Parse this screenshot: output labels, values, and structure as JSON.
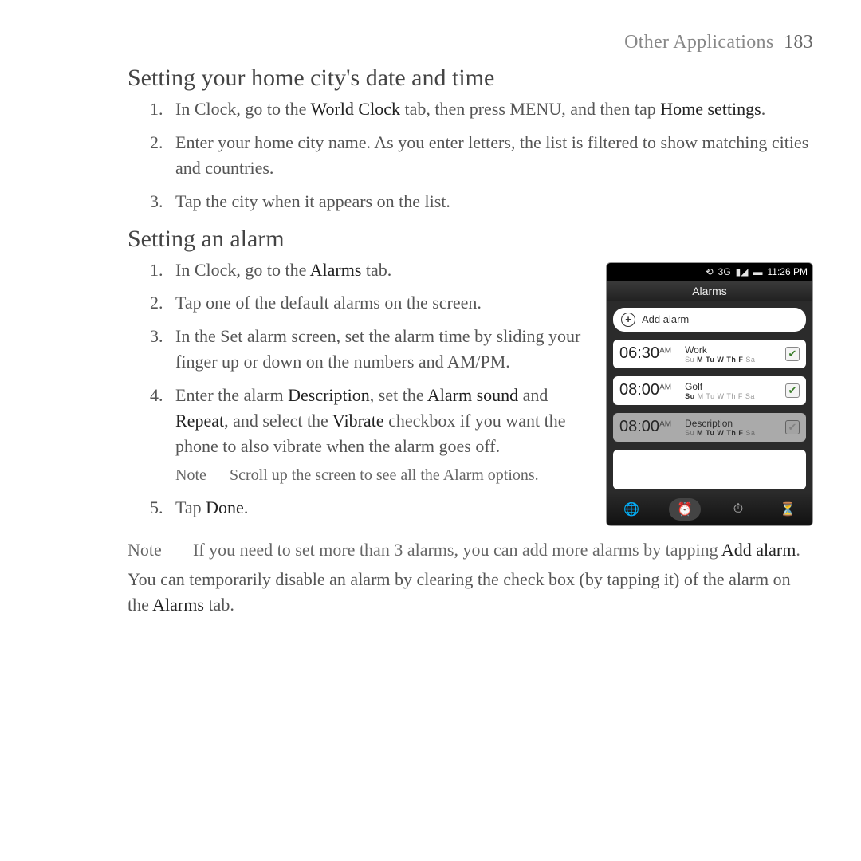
{
  "header": {
    "section": "Other Applications",
    "pageNumber": "183"
  },
  "sec1": {
    "heading": "Setting your home city's date and time",
    "items": [
      {
        "num": "1.",
        "pre": "In Clock, go to the ",
        "b1": "World Clock",
        "mid": " tab, then press MENU, and then tap ",
        "b2": "Home settings",
        "post": "."
      },
      {
        "num": "2.",
        "text": "Enter your home city name. As you enter letters, the list is filtered to show matching cities and countries."
      },
      {
        "num": "3.",
        "text": "Tap the city when it appears on the list."
      }
    ]
  },
  "sec2": {
    "heading": "Setting an alarm",
    "items": [
      {
        "num": "1.",
        "pre": "In Clock, go to the ",
        "b1": "Alarms",
        "post": " tab."
      },
      {
        "num": "2.",
        "text": "Tap one of the default alarms on the screen."
      },
      {
        "num": "3.",
        "text": "In the Set alarm screen, set the alarm time by sliding your finger up or down on the numbers and AM/PM."
      },
      {
        "num": "4.",
        "pre": "Enter the alarm ",
        "b1": "Description",
        "mid": ", set the ",
        "b2": "Alarm sound",
        "mid2": " and ",
        "b3": "Repeat",
        "mid3": ", and select the ",
        "b4": "Vibrate",
        "post": " checkbox if you want the phone to also vibrate when the alarm goes off."
      },
      {
        "note": true,
        "label": "Note",
        "text": "Scroll up the screen to see all the Alarm options."
      },
      {
        "num": "5.",
        "pre": "Tap ",
        "b1": "Done",
        "post": "."
      }
    ]
  },
  "bottomNote": {
    "label": "Note",
    "pre": "If you need to set more than 3 alarms, you can add more alarms by tapping ",
    "b1": "Add alarm",
    "post": "."
  },
  "para": {
    "pre": "You can temporarily disable an alarm by clearing the check box (by tapping it) of the alarm on the ",
    "b1": "Alarms",
    "post": " tab."
  },
  "phone": {
    "status": {
      "time": "11:26 PM",
      "icons": [
        "⟲",
        "3G",
        "▮◢",
        "▬"
      ]
    },
    "title": "Alarms",
    "addLabel": "Add alarm",
    "alarms": [
      {
        "time": "06:30",
        "ampm": "AM",
        "desc": "Work",
        "days": "Su M Tu W Th F Sa",
        "checked": true
      },
      {
        "time": "08:00",
        "ampm": "AM",
        "desc": "Golf",
        "days": "Su M Tu W Th F Sa",
        "checked": true
      },
      {
        "time": "08:00",
        "ampm": "AM",
        "desc": "Description",
        "days": "Su M Tu W Th F Sa",
        "checked": false
      }
    ],
    "tabs": [
      "globe",
      "alarm",
      "clock",
      "hourglass"
    ]
  }
}
